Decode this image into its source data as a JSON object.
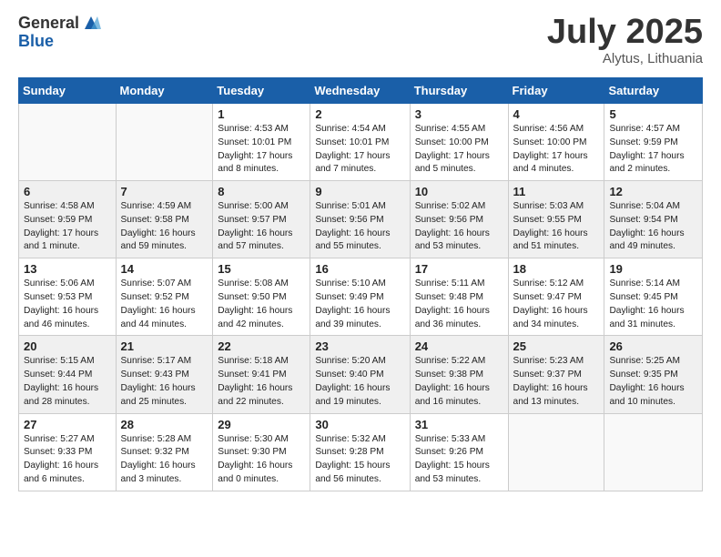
{
  "logo": {
    "general": "General",
    "blue": "Blue"
  },
  "title": "July 2025",
  "subtitle": "Alytus, Lithuania",
  "headers": [
    "Sunday",
    "Monday",
    "Tuesday",
    "Wednesday",
    "Thursday",
    "Friday",
    "Saturday"
  ],
  "weeks": [
    [
      {
        "day": "",
        "info": ""
      },
      {
        "day": "",
        "info": ""
      },
      {
        "day": "1",
        "info": "Sunrise: 4:53 AM\nSunset: 10:01 PM\nDaylight: 17 hours\nand 8 minutes."
      },
      {
        "day": "2",
        "info": "Sunrise: 4:54 AM\nSunset: 10:01 PM\nDaylight: 17 hours\nand 7 minutes."
      },
      {
        "day": "3",
        "info": "Sunrise: 4:55 AM\nSunset: 10:00 PM\nDaylight: 17 hours\nand 5 minutes."
      },
      {
        "day": "4",
        "info": "Sunrise: 4:56 AM\nSunset: 10:00 PM\nDaylight: 17 hours\nand 4 minutes."
      },
      {
        "day": "5",
        "info": "Sunrise: 4:57 AM\nSunset: 9:59 PM\nDaylight: 17 hours\nand 2 minutes."
      }
    ],
    [
      {
        "day": "6",
        "info": "Sunrise: 4:58 AM\nSunset: 9:59 PM\nDaylight: 17 hours\nand 1 minute."
      },
      {
        "day": "7",
        "info": "Sunrise: 4:59 AM\nSunset: 9:58 PM\nDaylight: 16 hours\nand 59 minutes."
      },
      {
        "day": "8",
        "info": "Sunrise: 5:00 AM\nSunset: 9:57 PM\nDaylight: 16 hours\nand 57 minutes."
      },
      {
        "day": "9",
        "info": "Sunrise: 5:01 AM\nSunset: 9:56 PM\nDaylight: 16 hours\nand 55 minutes."
      },
      {
        "day": "10",
        "info": "Sunrise: 5:02 AM\nSunset: 9:56 PM\nDaylight: 16 hours\nand 53 minutes."
      },
      {
        "day": "11",
        "info": "Sunrise: 5:03 AM\nSunset: 9:55 PM\nDaylight: 16 hours\nand 51 minutes."
      },
      {
        "day": "12",
        "info": "Sunrise: 5:04 AM\nSunset: 9:54 PM\nDaylight: 16 hours\nand 49 minutes."
      }
    ],
    [
      {
        "day": "13",
        "info": "Sunrise: 5:06 AM\nSunset: 9:53 PM\nDaylight: 16 hours\nand 46 minutes."
      },
      {
        "day": "14",
        "info": "Sunrise: 5:07 AM\nSunset: 9:52 PM\nDaylight: 16 hours\nand 44 minutes."
      },
      {
        "day": "15",
        "info": "Sunrise: 5:08 AM\nSunset: 9:50 PM\nDaylight: 16 hours\nand 42 minutes."
      },
      {
        "day": "16",
        "info": "Sunrise: 5:10 AM\nSunset: 9:49 PM\nDaylight: 16 hours\nand 39 minutes."
      },
      {
        "day": "17",
        "info": "Sunrise: 5:11 AM\nSunset: 9:48 PM\nDaylight: 16 hours\nand 36 minutes."
      },
      {
        "day": "18",
        "info": "Sunrise: 5:12 AM\nSunset: 9:47 PM\nDaylight: 16 hours\nand 34 minutes."
      },
      {
        "day": "19",
        "info": "Sunrise: 5:14 AM\nSunset: 9:45 PM\nDaylight: 16 hours\nand 31 minutes."
      }
    ],
    [
      {
        "day": "20",
        "info": "Sunrise: 5:15 AM\nSunset: 9:44 PM\nDaylight: 16 hours\nand 28 minutes."
      },
      {
        "day": "21",
        "info": "Sunrise: 5:17 AM\nSunset: 9:43 PM\nDaylight: 16 hours\nand 25 minutes."
      },
      {
        "day": "22",
        "info": "Sunrise: 5:18 AM\nSunset: 9:41 PM\nDaylight: 16 hours\nand 22 minutes."
      },
      {
        "day": "23",
        "info": "Sunrise: 5:20 AM\nSunset: 9:40 PM\nDaylight: 16 hours\nand 19 minutes."
      },
      {
        "day": "24",
        "info": "Sunrise: 5:22 AM\nSunset: 9:38 PM\nDaylight: 16 hours\nand 16 minutes."
      },
      {
        "day": "25",
        "info": "Sunrise: 5:23 AM\nSunset: 9:37 PM\nDaylight: 16 hours\nand 13 minutes."
      },
      {
        "day": "26",
        "info": "Sunrise: 5:25 AM\nSunset: 9:35 PM\nDaylight: 16 hours\nand 10 minutes."
      }
    ],
    [
      {
        "day": "27",
        "info": "Sunrise: 5:27 AM\nSunset: 9:33 PM\nDaylight: 16 hours\nand 6 minutes."
      },
      {
        "day": "28",
        "info": "Sunrise: 5:28 AM\nSunset: 9:32 PM\nDaylight: 16 hours\nand 3 minutes."
      },
      {
        "day": "29",
        "info": "Sunrise: 5:30 AM\nSunset: 9:30 PM\nDaylight: 16 hours\nand 0 minutes."
      },
      {
        "day": "30",
        "info": "Sunrise: 5:32 AM\nSunset: 9:28 PM\nDaylight: 15 hours\nand 56 minutes."
      },
      {
        "day": "31",
        "info": "Sunrise: 5:33 AM\nSunset: 9:26 PM\nDaylight: 15 hours\nand 53 minutes."
      },
      {
        "day": "",
        "info": ""
      },
      {
        "day": "",
        "info": ""
      }
    ]
  ]
}
